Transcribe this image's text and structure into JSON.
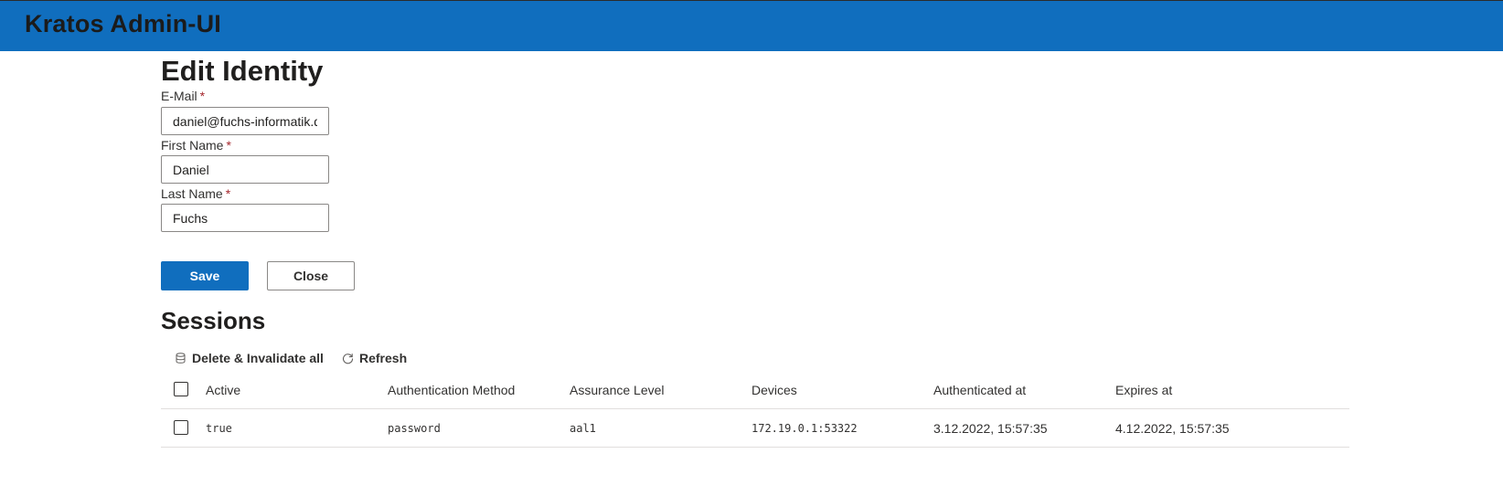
{
  "app": {
    "title": "Kratos Admin-UI",
    "brand_color": "#106ebe"
  },
  "form": {
    "title": "Edit Identity",
    "fields": [
      {
        "label": "E-Mail",
        "required_mark": "*",
        "value": "daniel@fuchs-informatik.de"
      },
      {
        "label": "First Name",
        "required_mark": "*",
        "value": "Daniel"
      },
      {
        "label": "Last Name",
        "required_mark": "*",
        "value": "Fuchs"
      }
    ],
    "save_label": "Save",
    "close_label": "Close"
  },
  "sessions": {
    "title": "Sessions",
    "commands": {
      "delete_all_label": "Delete & Invalidate all",
      "delete_all_icon": "delete-icon",
      "refresh_label": "Refresh",
      "refresh_icon": "refresh-icon"
    },
    "columns": [
      "Active",
      "Authentication Method",
      "Assurance Level",
      "Devices",
      "Authenticated at",
      "Expires at"
    ],
    "rows": [
      {
        "active": "true",
        "method": "password",
        "aal": "aal1",
        "devices": "172.19.0.1:53322",
        "authenticated_at": "3.12.2022, 15:57:35",
        "expires_at": "4.12.2022, 15:57:35"
      }
    ]
  }
}
